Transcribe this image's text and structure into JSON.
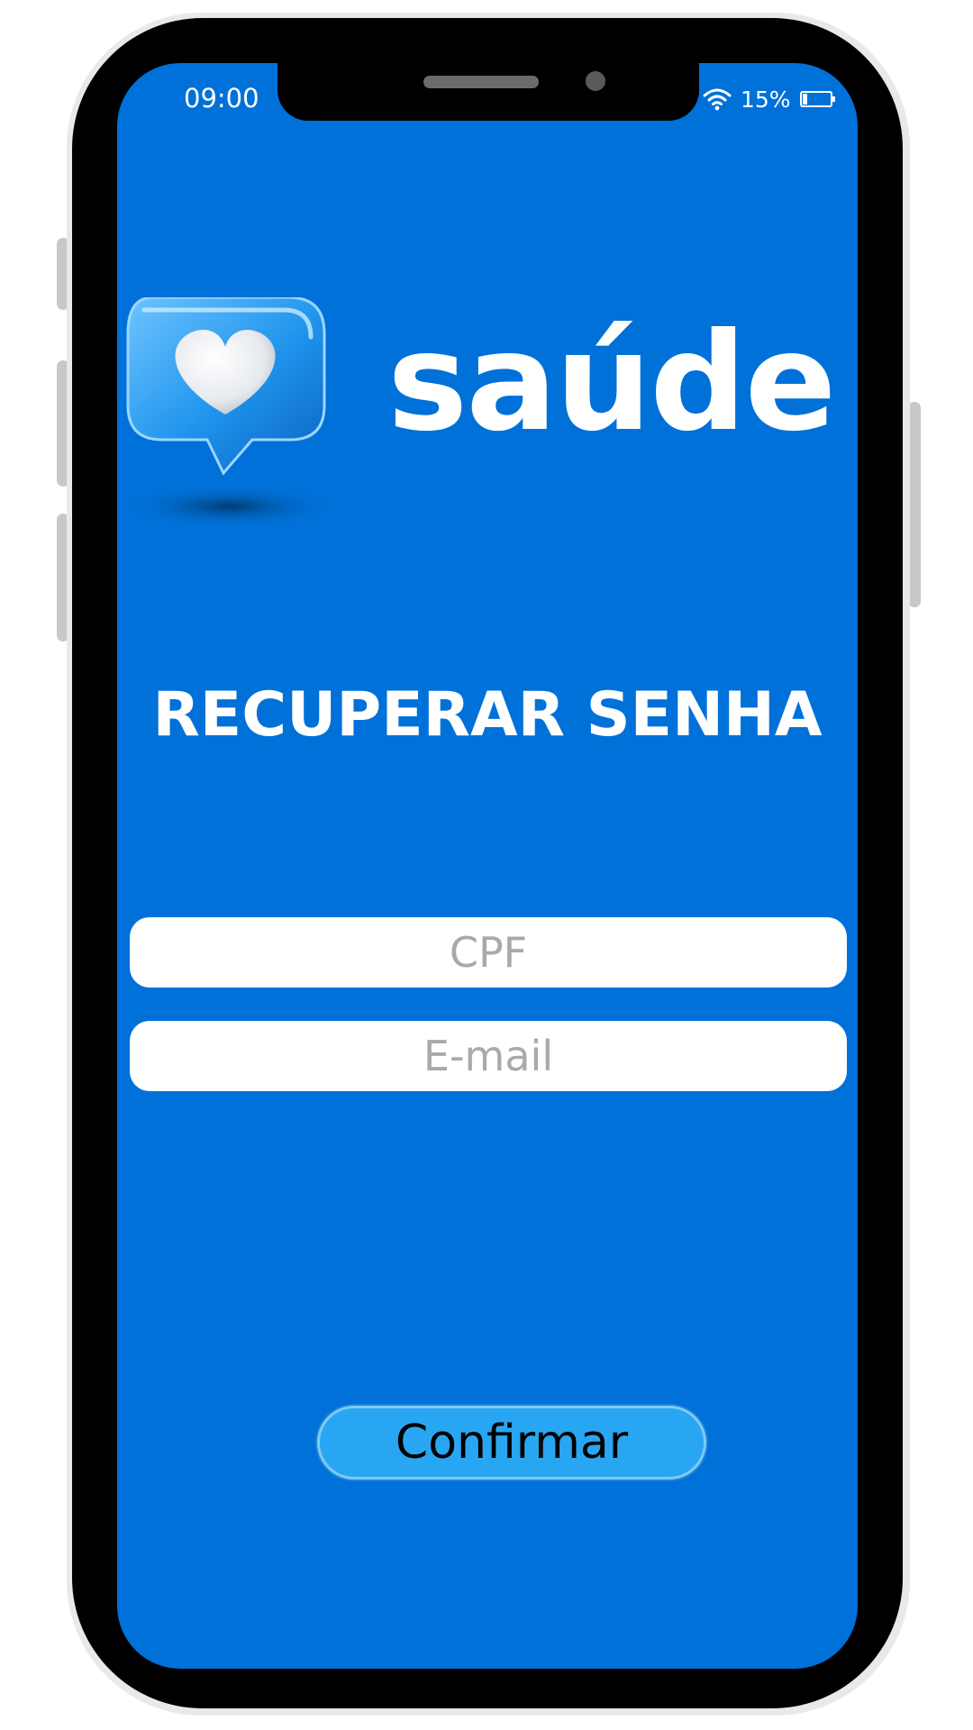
{
  "status_bar": {
    "time": "09:00",
    "battery": "15%",
    "icons": [
      "wifi-icon",
      "battery-icon"
    ]
  },
  "brand": {
    "name": "saúde",
    "logo_icon": "heart-speech-bubble-icon"
  },
  "page": {
    "title": "RECUPERAR SENHA"
  },
  "form": {
    "cpf_placeholder": "CPF",
    "email_placeholder": "E-mail",
    "confirm_label": "Confirmar"
  },
  "colors": {
    "screen_background": "#0071d8",
    "button_background": "#29a6f2",
    "text_primary": "#ffffff",
    "placeholder": "#a9a9a9"
  }
}
